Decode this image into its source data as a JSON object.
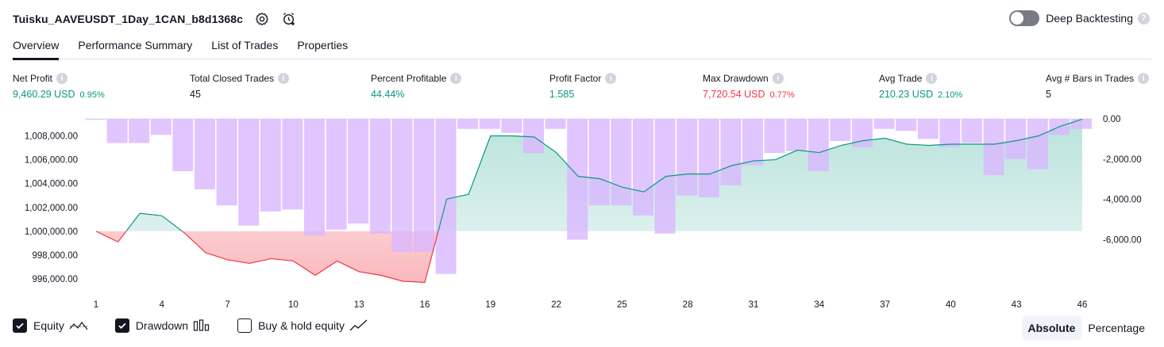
{
  "header": {
    "title": "Tuisku_AAVEUSDT_1Day_1CAN_b8d1368c",
    "settings_icon": "gear-icon",
    "alert_icon": "alarm-add-icon"
  },
  "deep_backtesting": {
    "label": "Deep Backtesting",
    "enabled": false,
    "help": "?"
  },
  "tabs": [
    {
      "label": "Overview",
      "active": true
    },
    {
      "label": "Performance Summary",
      "active": false
    },
    {
      "label": "List of Trades",
      "active": false
    },
    {
      "label": "Properties",
      "active": false
    }
  ],
  "metrics": {
    "help": "i",
    "net_profit": {
      "label": "Net Profit",
      "value": "9,460.29 USD",
      "pct": "0.95%"
    },
    "total_closed_trades": {
      "label": "Total Closed Trades",
      "value": "45"
    },
    "percent_profitable": {
      "label": "Percent Profitable",
      "value": "44.44%"
    },
    "profit_factor": {
      "label": "Profit Factor",
      "value": "1.585"
    },
    "max_drawdown": {
      "label": "Max Drawdown",
      "value": "7,720.54 USD",
      "pct": "0.77%"
    },
    "avg_trade": {
      "label": "Avg Trade",
      "value": "210.23 USD",
      "pct": "2.10%"
    },
    "avg_bars": {
      "label": "Avg # Bars in Trades",
      "value": "5"
    }
  },
  "chart_data": {
    "type": "area",
    "x_ticks": [
      "1",
      "4",
      "7",
      "10",
      "13",
      "16",
      "19",
      "22",
      "25",
      "28",
      "31",
      "34",
      "37",
      "40",
      "43",
      "46"
    ],
    "y_left_ticks": [
      "1,008,000.00",
      "1,006,000.00",
      "1,004,000.00",
      "1,002,000.00",
      "1,000,000.00",
      "998,000.00",
      "996,000.00"
    ],
    "y_right_ticks": [
      "0.00",
      "-2,000.00",
      "-4,000.00",
      "-6,000.00"
    ],
    "ylim_left": [
      994600,
      1009500
    ],
    "ylim_right": [
      -8000,
      0
    ],
    "baseline": 1000000,
    "series": [
      {
        "name": "Equity",
        "type": "line",
        "x": [
          1,
          2,
          3,
          4,
          5,
          6,
          7,
          8,
          9,
          10,
          11,
          12,
          13,
          14,
          15,
          16,
          17,
          18,
          19,
          20,
          21,
          22,
          23,
          24,
          25,
          26,
          27,
          28,
          29,
          30,
          31,
          32,
          33,
          34,
          35,
          36,
          37,
          38,
          39,
          40,
          41,
          42,
          43,
          44,
          45,
          46
        ],
        "values": [
          1000000,
          999100,
          1001500,
          1001300,
          999900,
          998200,
          997600,
          997300,
          997700,
          997500,
          996300,
          997500,
          996600,
          996300,
          995800,
          995700,
          1002700,
          1003100,
          1008000,
          1008000,
          1007900,
          1006600,
          1004600,
          1004400,
          1003700,
          1003300,
          1004600,
          1004800,
          1004800,
          1005500,
          1005900,
          1006000,
          1006800,
          1006600,
          1007200,
          1007600,
          1007800,
          1007300,
          1007200,
          1007300,
          1007300,
          1007300,
          1007600,
          1008000,
          1008800,
          1009400
        ]
      },
      {
        "name": "Drawdown",
        "type": "bar",
        "x": [
          1,
          2,
          3,
          4,
          5,
          6,
          7,
          8,
          9,
          10,
          11,
          12,
          13,
          14,
          15,
          16,
          17,
          18,
          19,
          20,
          21,
          22,
          23,
          24,
          25,
          26,
          27,
          28,
          29,
          30,
          31,
          32,
          33,
          34,
          35,
          36,
          37,
          38,
          39,
          40,
          41,
          42,
          43,
          44,
          45,
          46
        ],
        "values": [
          0,
          -1200,
          -1200,
          -800,
          -2600,
          -3500,
          -4300,
          -5300,
          -4600,
          -4500,
          -5800,
          -5500,
          -5200,
          -5700,
          -6600,
          -6600,
          -7700,
          -500,
          -500,
          -700,
          -1700,
          -500,
          -6000,
          -4300,
          -4300,
          -4800,
          -5700,
          -3800,
          -3900,
          -3300,
          -2300,
          -1700,
          -1600,
          -2600,
          -1100,
          -1400,
          -500,
          -600,
          -1000,
          -1400,
          -1200,
          -2800,
          -2000,
          -2500,
          -800,
          -500
        ]
      }
    ],
    "colors": {
      "equity_up": "#089981",
      "equity_down": "#f23645",
      "drawdown": "#d9b7ff"
    }
  },
  "legend": {
    "items": [
      {
        "label": "Equity",
        "checked": true,
        "icon": "equity-line-icon"
      },
      {
        "label": "Drawdown",
        "checked": true,
        "icon": "drawdown-bars-icon"
      },
      {
        "label": "Buy & hold equity",
        "checked": false,
        "icon": "buy-hold-line-icon"
      }
    ]
  },
  "modes": [
    {
      "label": "Absolute",
      "active": true
    },
    {
      "label": "Percentage",
      "active": false
    }
  ]
}
